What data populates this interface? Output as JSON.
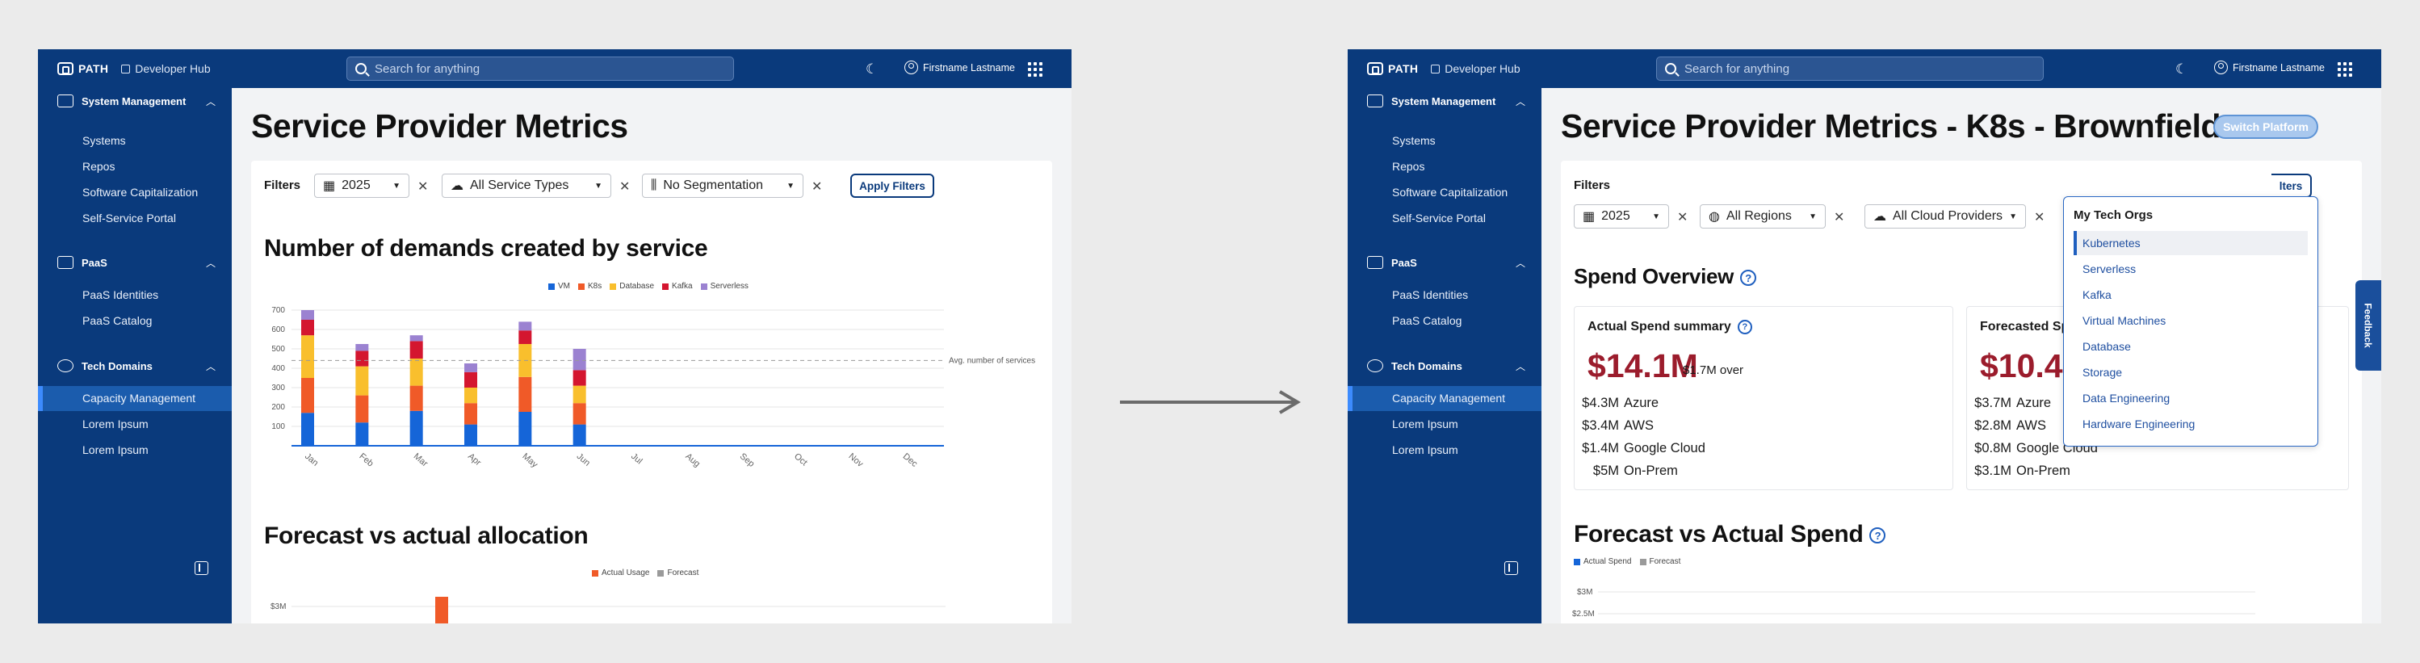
{
  "app": {
    "brand": "PATH",
    "hub": "Developer Hub",
    "search_placeholder": "Search for anything",
    "user_name": "Firstname Lastname"
  },
  "sidebar": {
    "sections": [
      {
        "title": "System Management",
        "items": [
          "Systems",
          "Repos",
          "Software Capitalization",
          "Self-Service Portal"
        ]
      },
      {
        "title": "PaaS",
        "items": [
          "PaaS Identities",
          "PaaS Catalog"
        ]
      },
      {
        "title": "Tech Domains",
        "items": [
          "Capacity Management",
          "Lorem Ipsum",
          "Lorem Ipsum"
        ]
      }
    ],
    "active_item": "Capacity Management"
  },
  "left": {
    "title": "Service Provider Metrics",
    "filters_label": "Filters",
    "filter_year": "2025",
    "filter_service": "All Service Types",
    "filter_segment": "No Segmentation",
    "apply": "Apply Filters",
    "demands_title": "Number of demands created by service",
    "forecast_title": "Forecast vs actual allocation",
    "forecast_legend": [
      "Actual Usage",
      "Forecast"
    ],
    "forecast_tick": "$3M",
    "avg_label": "Avg. number of services"
  },
  "right": {
    "title": "Service Provider Metrics - K8s - Brownfield",
    "switch": "Switch Platform",
    "filters_label": "Filters",
    "filter_year": "2025",
    "filter_region": "All Regions",
    "filter_cloud": "All Cloud Providers",
    "apply_partial": "lters",
    "spend_overview": "Spend Overview",
    "actual_title": "Actual Spend summary",
    "actual_total": "$14.1M",
    "actual_over": "$1.7M over",
    "actual_rows": [
      {
        "v": "$4.3M",
        "l": "Azure"
      },
      {
        "v": "$3.4M",
        "l": "AWS"
      },
      {
        "v": "$1.4M",
        "l": "Google Cloud"
      },
      {
        "v": "$5M",
        "l": "On-Prem"
      }
    ],
    "forecast_title_partial": "Forecasted Sp",
    "forecast_total_partial": "$10.4",
    "forecast_rows": [
      {
        "v": "$3.7M",
        "l": "Azure"
      },
      {
        "v": "$2.8M",
        "l": "AWS"
      },
      {
        "v": "$0.8M",
        "l": "Google Cloud"
      },
      {
        "v": "$3.1M",
        "l": "On-Prem"
      }
    ],
    "fva_title": "Forecast vs Actual Spend",
    "fva_legend": [
      "Actual Spend",
      "Forecast"
    ],
    "fva_ticks": [
      "$3M",
      "$2.5M"
    ],
    "dropdown_title": "My Tech Orgs",
    "dropdown_items": [
      "Kubernetes",
      "Serverless",
      "Kafka",
      "Virtual Machines",
      "Database",
      "Storage",
      "Data Engineering",
      "Hardware Engineering"
    ],
    "dropdown_selected": "Kubernetes",
    "feedback": "Feedback"
  },
  "colors": {
    "VM": "#1565d8",
    "K8s": "#f05a28",
    "Database": "#f9bf2d",
    "Kafka": "#d4162f",
    "Serverless": "#9b82d1",
    "Forecast": "#9a9a9a",
    "nav": "#0a3a7c",
    "accent": "#9b1c2c"
  },
  "chart_data": {
    "type": "bar",
    "categories": [
      "Jan",
      "Feb",
      "Mar",
      "Apr",
      "May",
      "Jun",
      "Jul",
      "Aug",
      "Sep",
      "Oct",
      "Nov",
      "Dec"
    ],
    "series": [
      {
        "name": "VM",
        "values": [
          170,
          120,
          180,
          110,
          175,
          110,
          0,
          0,
          0,
          0,
          0,
          0
        ]
      },
      {
        "name": "K8s",
        "values": [
          180,
          140,
          130,
          110,
          180,
          110,
          0,
          0,
          0,
          0,
          0,
          0
        ]
      },
      {
        "name": "Database",
        "values": [
          220,
          150,
          140,
          80,
          170,
          90,
          0,
          0,
          0,
          0,
          0,
          0
        ]
      },
      {
        "name": "Kafka",
        "values": [
          80,
          80,
          90,
          80,
          70,
          80,
          0,
          0,
          0,
          0,
          0,
          0
        ]
      },
      {
        "name": "Serverless",
        "values": [
          50,
          35,
          30,
          45,
          45,
          110,
          0,
          0,
          0,
          0,
          0,
          0
        ]
      }
    ],
    "yticks": [
      100,
      200,
      300,
      400,
      500,
      600,
      700
    ],
    "ylim": [
      0,
      750
    ],
    "avg_line": 440
  }
}
